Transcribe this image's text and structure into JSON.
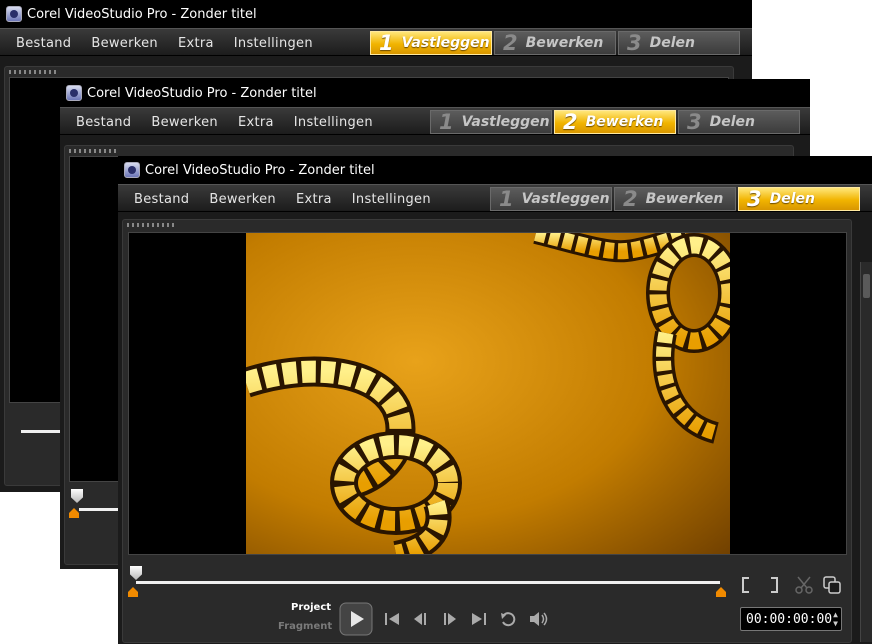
{
  "windows": [
    {
      "title": "Corel VideoStudio Pro - Zonder titel",
      "active_step": 1
    },
    {
      "title": "Corel VideoStudio Pro - Zonder titel",
      "active_step": 2
    },
    {
      "title": "Corel VideoStudio Pro - Zonder titel",
      "active_step": 3
    }
  ],
  "menu": {
    "file": "Bestand",
    "edit": "Bewerken",
    "extra": "Extra",
    "settings": "Instellingen"
  },
  "steps": [
    {
      "num": "1",
      "label": "Vastleggen"
    },
    {
      "num": "2",
      "label": "Bewerken"
    },
    {
      "num": "3",
      "label": "Delen"
    }
  ],
  "player": {
    "mode_project": "Project",
    "mode_fragment": "Fragment",
    "timecode": "00:00:00:00",
    "active_mode": "Project"
  },
  "colors": {
    "accent": "#f1b400",
    "film_background": "#c98400"
  },
  "icons": [
    "app-icon",
    "play-icon",
    "home-icon",
    "previous-frame-icon",
    "next-frame-icon",
    "end-icon",
    "repeat-icon",
    "volume-icon",
    "mark-in-icon",
    "mark-out-icon",
    "scissors-icon",
    "copy-icon"
  ]
}
